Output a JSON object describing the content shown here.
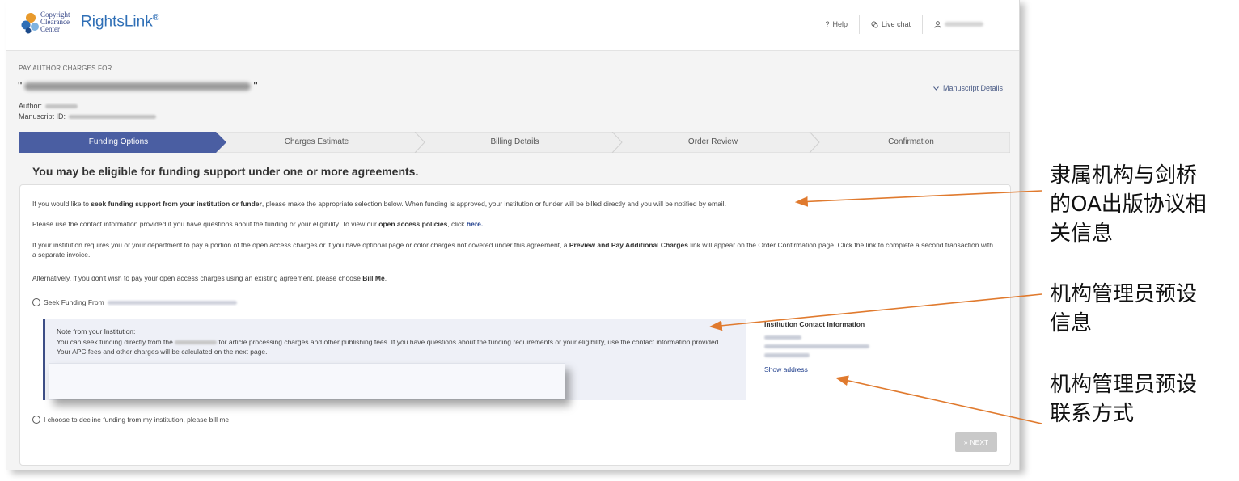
{
  "header": {
    "logo_lines": [
      "Copyright",
      "Clearance",
      "Center"
    ],
    "brand": "RightsLink",
    "brand_mark": "®",
    "help": "Help",
    "live_chat": "Live chat"
  },
  "page": {
    "pay_for_label": "PAY AUTHOR CHARGES FOR",
    "quote_open": "\"",
    "quote_close": "\"",
    "author_label": "Author:",
    "manuscript_id_label": "Manuscript ID:",
    "manuscript_details": "Manuscript Details"
  },
  "stepper": {
    "steps": [
      "Funding Options",
      "Charges Estimate",
      "Billing Details",
      "Order Review",
      "Confirmation"
    ],
    "active_index": 0
  },
  "main": {
    "heading": "You may be eligible for funding support under one or more agreements.",
    "p1_pre": "If you would like to ",
    "p1_bold": "seek funding support from your institution or funder",
    "p1_post": ", please make the appropriate selection below. When funding is approved, your institution or funder will be billed directly and you will be notified by email.",
    "p2_pre": "Please use the contact information provided if you have questions about the funding or your eligibility. To view our ",
    "p2_bold": "open access policies",
    "p2_mid": ", click ",
    "p2_link": "here.",
    "p3_pre": "If your institution requires you or your department to pay a portion of the open access charges or if you have optional page or color charges not covered under this agreement, a ",
    "p3_bold": "Preview and Pay Additional Charges",
    "p3_post": " link will appear on the Order Confirmation page. Click the link to complete a second transaction with a separate invoice.",
    "p4_pre": "Alternatively, if you don't wish to pay your open access charges using an existing agreement, please choose ",
    "p4_bold": "Bill Me",
    "p4_post": ".",
    "seek_funding_label": "Seek Funding From",
    "note_title": "Note from your Institution:",
    "note_pre": "You can seek funding directly from the ",
    "note_post": " for article processing charges and other publishing fees. If you have questions about the funding requirements or your eligibility, use the contact information provided.  Your APC fees and other charges will be calculated on the next page.",
    "contact_title": "Institution Contact Information",
    "show_address": "Show address",
    "decline_label": "I choose to decline funding from my institution, please bill me",
    "next_button": "NEXT",
    "next_icon": "»"
  },
  "annotations": [
    "隶属机构与剑桥的OA出版协议相关信息",
    "机构管理员预设信息",
    "机构管理员预设联系方式"
  ],
  "annotation_lines": [
    [
      "隶属机构与剑桥",
      "的OA出版协议相",
      "关信息"
    ],
    [
      "机构管理员预设",
      "信息"
    ],
    [
      "机构管理员预设",
      "联系方式"
    ]
  ],
  "colors": {
    "step_active": "#4a5ea2",
    "step_inactive": "#eeeeee",
    "annotation_arrow": "#e07a2e",
    "link": "#1f3e8c"
  }
}
